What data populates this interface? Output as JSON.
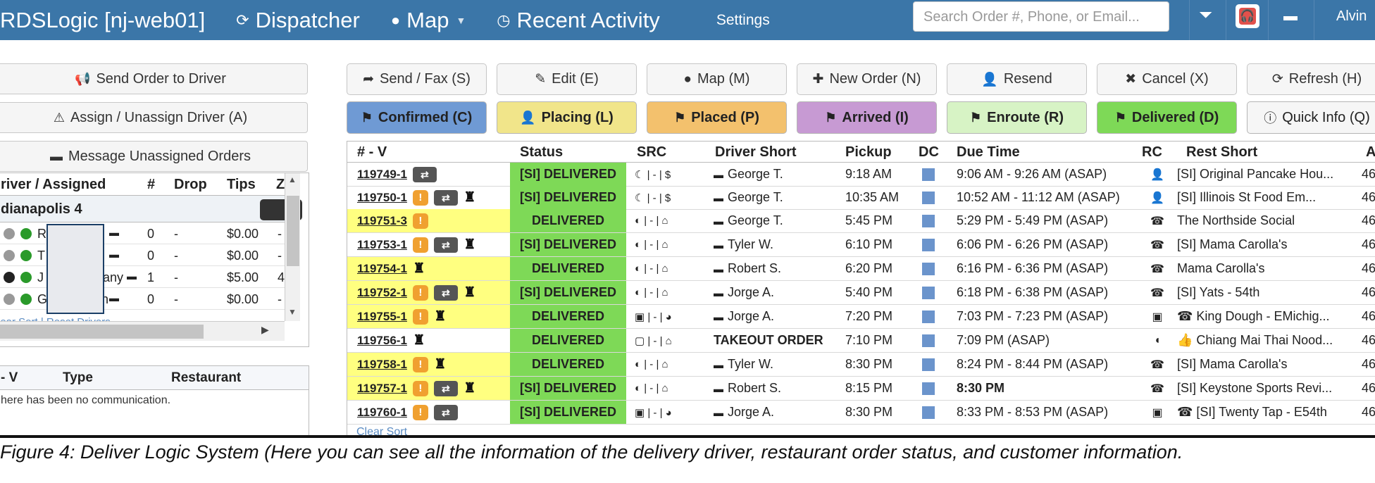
{
  "topnav": {
    "brand": "RDSLogic [nj-web01]",
    "items": [
      {
        "icon": "refresh-icon",
        "glyph": "⟳",
        "label": "Dispatcher"
      },
      {
        "icon": "globe-icon",
        "glyph": "●",
        "label": "Map"
      },
      {
        "icon": "clock-icon",
        "glyph": "◷",
        "label": "Recent Activity"
      }
    ],
    "settings": "Settings",
    "search_placeholder": "Search Order #, Phone, or Email...",
    "user": "Alvin"
  },
  "left": {
    "buttons": [
      {
        "label": "Send Order to Driver",
        "icon": "megaphone-icon",
        "glyph": "📢"
      },
      {
        "label": "Assign / Unassign Driver (A)",
        "icon": "driver-icon",
        "glyph": "⚠"
      },
      {
        "label": "Message Unassigned Orders",
        "icon": "chat-icon",
        "glyph": "▬"
      }
    ],
    "drivers": {
      "headers": [
        "river / Assigned",
        "#",
        "Drop",
        "Tips",
        "Z"
      ],
      "group": "dianapolis  4",
      "rows": [
        {
          "name": "R",
          "suffix": "s",
          "count": "0",
          "drop": "-",
          "tips": "$0.00",
          "z": "-",
          "globe": "light"
        },
        {
          "name": "T",
          "suffix": "",
          "count": "0",
          "drop": "-",
          "tips": "$0.00",
          "z": "-",
          "globe": "light"
        },
        {
          "name": "J",
          "suffix": "any",
          "count": "1",
          "drop": "-",
          "tips": "$5.00",
          "z": "4",
          "globe": "dark"
        },
        {
          "name": "G",
          "suffix": "an",
          "count": "0",
          "drop": "-",
          "tips": "$0.00",
          "z": "-",
          "globe": "light"
        }
      ],
      "clear_sort": "lear Sort | Reset Drivers"
    },
    "comm": {
      "headers": [
        "- V",
        "Type",
        "Restaurant"
      ],
      "empty": "here has been no communication."
    }
  },
  "actions": {
    "row1": [
      {
        "label": "Send / Fax (S)",
        "icon": "share-icon",
        "glyph": "➦"
      },
      {
        "label": "Edit (E)",
        "icon": "edit-icon",
        "glyph": "✎"
      },
      {
        "label": "Map (M)",
        "icon": "globe-icon",
        "glyph": "●"
      },
      {
        "label": "New Order (N)",
        "icon": "plus-icon",
        "glyph": "✚"
      },
      {
        "label": "Resend",
        "icon": "user-icon",
        "glyph": "👤"
      },
      {
        "label": "Cancel (X)",
        "icon": "close-icon",
        "glyph": "✖"
      },
      {
        "label": "Refresh (H)",
        "icon": "refresh-icon",
        "glyph": "⟳"
      }
    ],
    "row2": [
      {
        "label": "Confirmed (C)",
        "color": "#6f9ad4"
      },
      {
        "label": "Placing (L)",
        "color": "#f1e58a"
      },
      {
        "label": "Placed (P)",
        "color": "#f3c16d"
      },
      {
        "label": "Arrived (I)",
        "color": "#c79ad3"
      },
      {
        "label": "Enroute (R)",
        "color": "#d7f3c5"
      },
      {
        "label": "Delivered (D)",
        "color": "#7ed957"
      },
      {
        "label": "Quick Info (Q)",
        "color": "#f6f6f6"
      }
    ]
  },
  "orders": {
    "headers": [
      "# - V",
      "Status",
      "SRC",
      "Driver Short",
      "Pickup",
      "DC",
      "Due Time",
      "RC",
      "Rest Short",
      "A"
    ],
    "rows": [
      {
        "id": "119749-1",
        "flags": [
          "ret"
        ],
        "status": "[SI] DELIVERED",
        "src": "☾ | - | $",
        "driver": "George T.",
        "chat": true,
        "pickup": "9:18 AM",
        "due": "9:06 AM - 9:26 AM (ASAP)",
        "rc": "👤",
        "rest": "[SI] Original Pancake Hou...",
        "a": "46",
        "yellow": false
      },
      {
        "id": "119750-1",
        "flags": [
          "warn",
          "ret",
          "tip"
        ],
        "status": "[SI] DELIVERED",
        "src": "☾ | - | $",
        "driver": "George T.",
        "chat": true,
        "pickup": "10:35 AM",
        "due": "10:52 AM - 11:12 AM (ASAP)",
        "rc": "👤",
        "rest": "[SI] Illinois St Food Em...",
        "a": "46",
        "yellow": false
      },
      {
        "id": "119751-3",
        "flags": [
          "warn"
        ],
        "status": "DELIVERED",
        "src": "◐ | - | ⌂",
        "driver": "George T.",
        "chat": true,
        "pickup": "5:45 PM",
        "due": "5:29 PM - 5:49 PM (ASAP)",
        "rc": "☎",
        "rest": "The Northside Social",
        "a": "46",
        "yellow": true
      },
      {
        "id": "119753-1",
        "flags": [
          "warn",
          "ret",
          "tip"
        ],
        "status": "[SI] DELIVERED",
        "src": "◐ | - | ⌂",
        "driver": "Tyler W.",
        "chat": true,
        "pickup": "6:10 PM",
        "due": "6:06 PM - 6:26 PM (ASAP)",
        "rc": "☎",
        "rest": "[SI] Mama Carolla's",
        "a": "46",
        "yellow": false
      },
      {
        "id": "119754-1",
        "flags": [
          "tip"
        ],
        "status": "DELIVERED",
        "src": "◐ | - | ⌂",
        "driver": "Robert S.",
        "chat": true,
        "pickup": "6:20 PM",
        "due": "6:16 PM - 6:36 PM (ASAP)",
        "rc": "☎",
        "rest": "Mama Carolla's",
        "a": "46",
        "yellow": true
      },
      {
        "id": "119752-1",
        "flags": [
          "warn",
          "ret",
          "tip"
        ],
        "status": "[SI] DELIVERED",
        "src": "◐ | - | ⌂",
        "driver": "Jorge A.",
        "chat": true,
        "pickup": "5:40 PM",
        "due": "6:18 PM - 6:38 PM (ASAP)",
        "rc": "☎",
        "rest": "[SI] Yats - 54th",
        "a": "46",
        "yellow": true
      },
      {
        "id": "119755-1",
        "flags": [
          "warn",
          "tip"
        ],
        "status": "DELIVERED",
        "src": "▣ | - | ◕",
        "driver": "Jorge A.",
        "chat": true,
        "pickup": "7:20 PM",
        "due": "7:03 PM - 7:23 PM (ASAP)",
        "rc": "▣",
        "rest": "☎ King Dough - EMichig...",
        "a": "46",
        "yellow": true
      },
      {
        "id": "119756-1",
        "flags": [
          "tip"
        ],
        "status": "DELIVERED",
        "src": "▢ | - | ⌂",
        "driver": "TAKEOUT ORDER",
        "chat": false,
        "pickup": "7:10 PM",
        "due": "7:09 PM (ASAP)",
        "rc": "◖",
        "rest": "👍 Chiang Mai Thai Nood...",
        "a": "46",
        "yellow": false
      },
      {
        "id": "119758-1",
        "flags": [
          "warn",
          "tip"
        ],
        "status": "DELIVERED",
        "src": "◐ | - | ⌂",
        "driver": "Tyler W.",
        "chat": true,
        "pickup": "8:30 PM",
        "due": "8:24 PM - 8:44 PM (ASAP)",
        "rc": "☎",
        "rest": "[SI] Mama Carolla's",
        "a": "46",
        "yellow": true
      },
      {
        "id": "119757-1",
        "flags": [
          "warn",
          "ret",
          "tip"
        ],
        "status": "[SI] DELIVERED",
        "src": "◐ | - | ⌂",
        "driver": "Robert S.",
        "chat": true,
        "pickup": "8:15 PM",
        "due": "8:30 PM",
        "rc": "☎",
        "rest": "[SI] Keystone Sports Revi...",
        "a": "46",
        "yellow": true
      },
      {
        "id": "119760-1",
        "flags": [
          "warn",
          "ret"
        ],
        "status": "[SI] DELIVERED",
        "src": "▣ | - | ◕",
        "driver": "Jorge A.",
        "chat": true,
        "pickup": "8:30 PM",
        "due": "8:33 PM - 8:53 PM (ASAP)",
        "rc": "▣",
        "rest": "☎ [SI] Twenty Tap - E54th",
        "a": "46",
        "yellow": false
      }
    ],
    "clear_sort": "Clear Sort"
  },
  "caption": "Figure 4: Deliver Logic System (Here you can see all the information of the delivery driver, restaurant order status, and customer information."
}
